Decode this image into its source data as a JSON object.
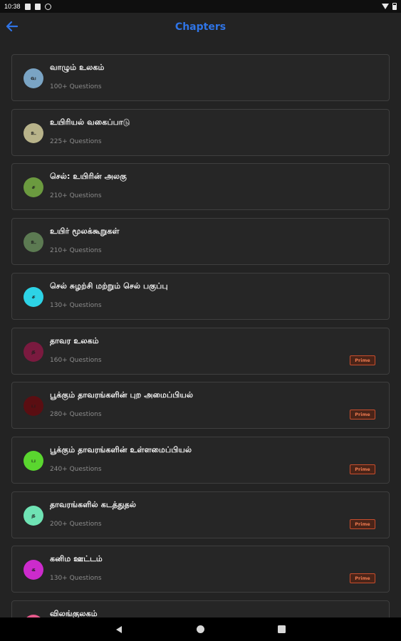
{
  "status_bar": {
    "time": "10:38"
  },
  "header": {
    "title": "Chapters"
  },
  "chapters": [
    {
      "title": "வாழும் உலகம்",
      "count": "100+ Questions",
      "initial": "வ",
      "color": "#7aa4c4",
      "prime": false
    },
    {
      "title": "உயிரியல் வகைப்பாடு",
      "count": "225+ Questions",
      "initial": "உ",
      "color": "#b8b38a",
      "prime": false
    },
    {
      "title": "செல்: உயிரின் அலகு",
      "count": "210+ Questions",
      "initial": "ச",
      "color": "#6b9a3f",
      "prime": false
    },
    {
      "title": "உயிர் மூலக்கூறுகள்",
      "count": "210+ Questions",
      "initial": "உ",
      "color": "#5c7a52",
      "prime": false
    },
    {
      "title": "செல் சுழற்சி மற்றும் செல் பகுப்பு",
      "count": "130+ Questions",
      "initial": "ச",
      "color": "#2dd3e6",
      "prime": false
    },
    {
      "title": "தாவர உலகம்",
      "count": "160+ Questions",
      "initial": "த",
      "color": "#7a1a3f",
      "prime": true,
      "prime_label": "Prime"
    },
    {
      "title": "பூக்கும் தாவரங்களின் புற அமைப்பியல்",
      "count": "280+ Questions",
      "initial": "ப",
      "color": "#5a0e12",
      "prime": true,
      "prime_label": "Prime"
    },
    {
      "title": "பூக்கும் தாவரங்களின் உள்ளமைப்பியல்",
      "count": "240+ Questions",
      "initial": "ப",
      "color": "#5ad62f",
      "prime": true,
      "prime_label": "Prime"
    },
    {
      "title": "தாவரங்களில் கடத்துதல்",
      "count": "200+ Questions",
      "initial": "த",
      "color": "#6fe3b4",
      "prime": true,
      "prime_label": "Prime"
    },
    {
      "title": "கனிம ஊட்டம்",
      "count": "130+ Questions",
      "initial": "க",
      "color": "#cc2bcc",
      "prime": true,
      "prime_label": "Prime"
    },
    {
      "title": "விலங்குலகம்",
      "count": "",
      "initial": "வ",
      "color": "#e85a8c",
      "prime": false
    }
  ]
}
